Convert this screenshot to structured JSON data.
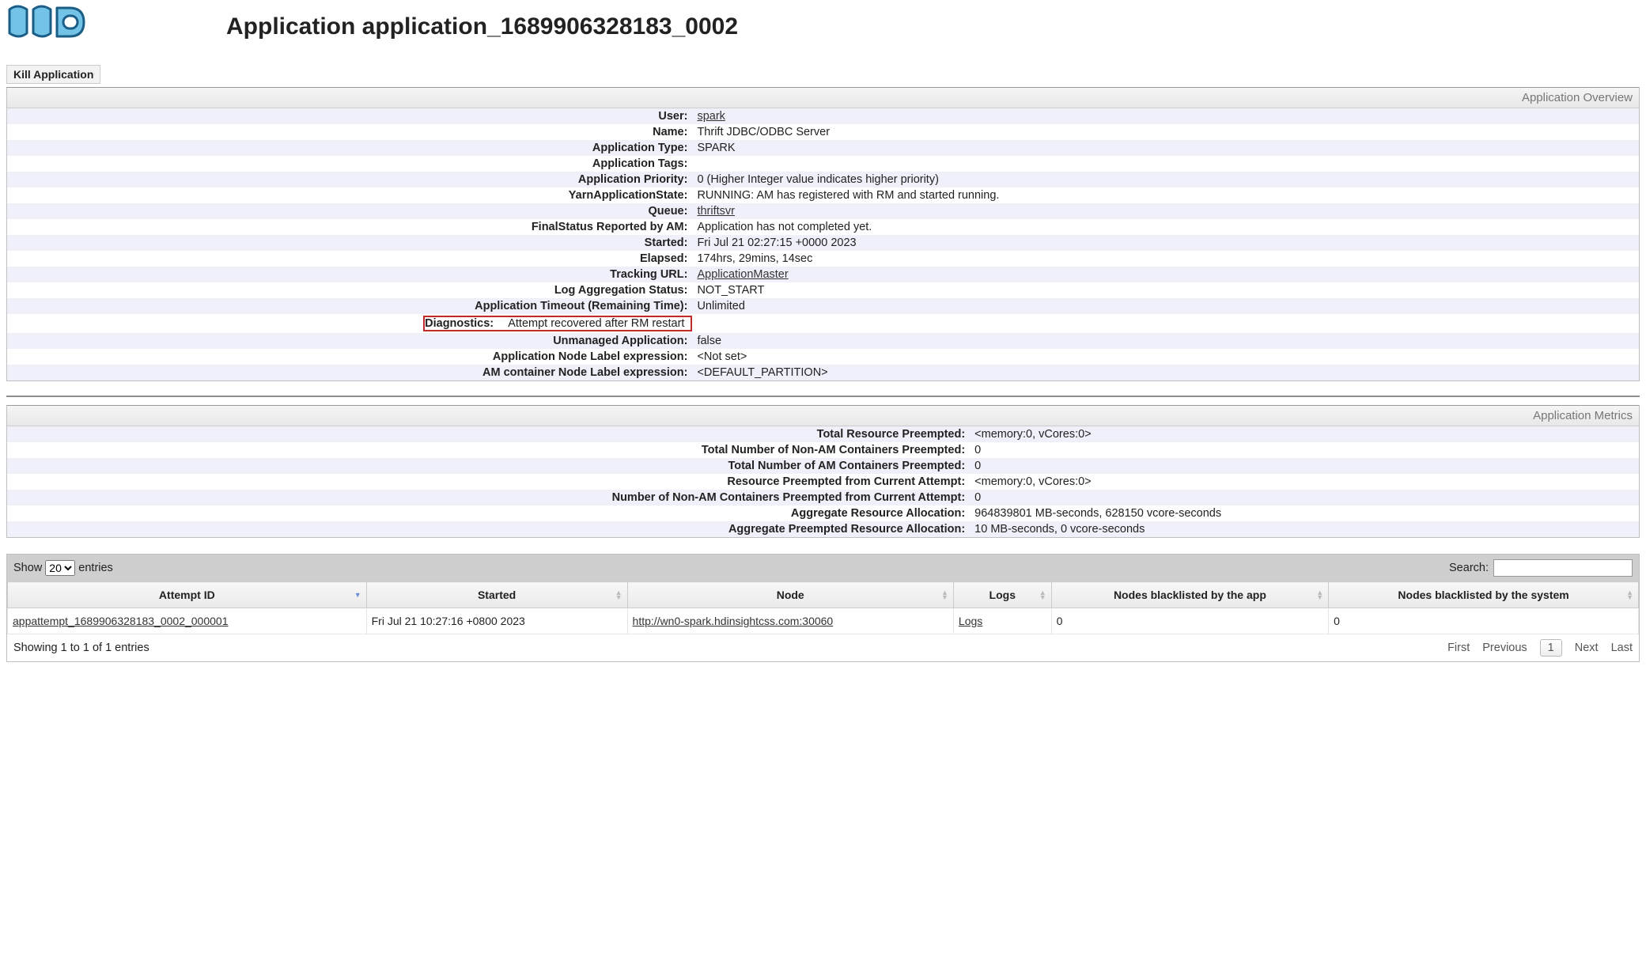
{
  "header": {
    "page_title": "Application application_1689906328183_0002",
    "kill_button_label": "Kill Application"
  },
  "overview": {
    "panel_title": "Application Overview",
    "rows": {
      "user": {
        "label": "User:",
        "value": "spark",
        "link": true
      },
      "name": {
        "label": "Name:",
        "value": "Thrift JDBC/ODBC Server"
      },
      "app_type": {
        "label": "Application Type:",
        "value": "SPARK"
      },
      "app_tags": {
        "label": "Application Tags:",
        "value": ""
      },
      "priority": {
        "label": "Application Priority:",
        "value": "0 (Higher Integer value indicates higher priority)"
      },
      "yarn_state": {
        "label": "YarnApplicationState:",
        "value": "RUNNING: AM has registered with RM and started running."
      },
      "queue": {
        "label": "Queue:",
        "value": "thriftsvr",
        "link": true
      },
      "final_status": {
        "label": "FinalStatus Reported by AM:",
        "value": "Application has not completed yet."
      },
      "started": {
        "label": "Started:",
        "value": "Fri Jul 21 02:27:15 +0000 2023"
      },
      "elapsed": {
        "label": "Elapsed:",
        "value": "174hrs, 29mins, 14sec"
      },
      "tracking_url": {
        "label": "Tracking URL:",
        "value": "ApplicationMaster",
        "link": true
      },
      "log_agg": {
        "label": "Log Aggregation Status:",
        "value": "NOT_START"
      },
      "timeout": {
        "label": "Application Timeout (Remaining Time):",
        "value": "Unlimited"
      },
      "diagnostics": {
        "label": "Diagnostics:",
        "value": "Attempt recovered after RM restart"
      },
      "unmanaged": {
        "label": "Unmanaged Application:",
        "value": "false"
      },
      "app_node_label": {
        "label": "Application Node Label expression:",
        "value": "<Not set>"
      },
      "am_node_label": {
        "label": "AM container Node Label expression:",
        "value": "<DEFAULT_PARTITION>"
      }
    }
  },
  "metrics": {
    "panel_title": "Application Metrics",
    "rows": {
      "total_resource_preempted": {
        "label": "Total Resource Preempted:",
        "value": "<memory:0, vCores:0>"
      },
      "total_nonam_preempted": {
        "label": "Total Number of Non-AM Containers Preempted:",
        "value": "0"
      },
      "total_am_preempted": {
        "label": "Total Number of AM Containers Preempted:",
        "value": "0"
      },
      "resource_preempted_current": {
        "label": "Resource Preempted from Current Attempt:",
        "value": "<memory:0, vCores:0>"
      },
      "nonam_preempted_current": {
        "label": "Number of Non-AM Containers Preempted from Current Attempt:",
        "value": "0"
      },
      "aggregate_resource_alloc": {
        "label": "Aggregate Resource Allocation:",
        "value": "964839801 MB-seconds, 628150 vcore-seconds"
      },
      "aggregate_preempted_alloc": {
        "label": "Aggregate Preempted Resource Allocation:",
        "value": "10 MB-seconds, 0 vcore-seconds"
      }
    }
  },
  "attempts": {
    "show_label_prefix": "Show",
    "show_label_suffix": "entries",
    "show_value": "20",
    "search_label": "Search:",
    "columns": {
      "attempt_id": "Attempt ID",
      "started": "Started",
      "node": "Node",
      "logs": "Logs",
      "blacklist_app": "Nodes blacklisted by the app",
      "blacklist_system": "Nodes blacklisted by the system"
    },
    "rows": [
      {
        "attempt_id": "appattempt_1689906328183_0002_000001",
        "started": "Fri Jul 21 10:27:16 +0800 2023",
        "node": "http://wn0-spark.hdinsightcss.com:30060",
        "logs": "Logs",
        "blacklist_app": "0",
        "blacklist_system": "0"
      }
    ],
    "footer_info": "Showing 1 to 1 of 1 entries",
    "pager": {
      "first": "First",
      "previous": "Previous",
      "page": "1",
      "next": "Next",
      "last": "Last"
    }
  }
}
